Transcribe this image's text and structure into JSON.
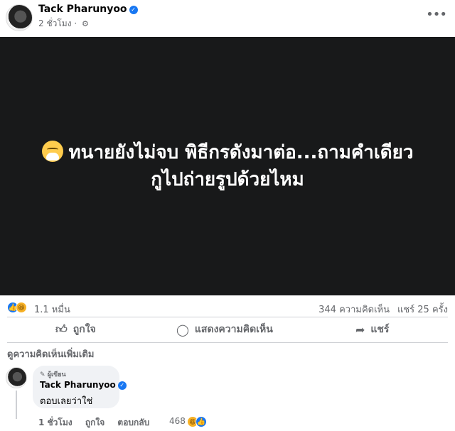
{
  "post": {
    "author": "Tack Pharunyoo",
    "time": "2 ชั่วโมง",
    "separator": "·",
    "media_text_line1": "ทนายยังไม่จบ พิธีกรดังมาต่อ...ถามคำเดียว",
    "media_text_line2": "กูไปถ่ายรูปด้วยไหม"
  },
  "stats": {
    "reactions": "1.1 หมื่น",
    "comments": "344 ความคิดเห็น",
    "shares": "แชร์ 25 ครั้ง"
  },
  "actions": {
    "like": "ถูกใจ",
    "comment": "แสดงความคิดเห็น",
    "share": "แชร์"
  },
  "comments_section": {
    "view_more": "ดูความคิดเห็นเพิ่มเติม",
    "comment": {
      "badge": "ผู้เขียน",
      "author": "Tack Pharunyoo",
      "text": "ตอบเลยว่าใช่",
      "time": "1 ชั่วโมง",
      "like": "ถูกใจ",
      "reply": "ตอบกลับ",
      "reactions": "468"
    }
  },
  "icons": {
    "more": "more-horizontal-icon",
    "privacy": "gear-icon",
    "verified": "verified-badge-icon",
    "like": "thumbs-up-icon",
    "comment": "speech-bubble-icon",
    "share": "share-arrow-icon"
  },
  "colors": {
    "accent": "#1877f2",
    "media_bg": "#18191a",
    "muted_text": "#65676b",
    "bubble_bg": "#f0f2f5"
  }
}
